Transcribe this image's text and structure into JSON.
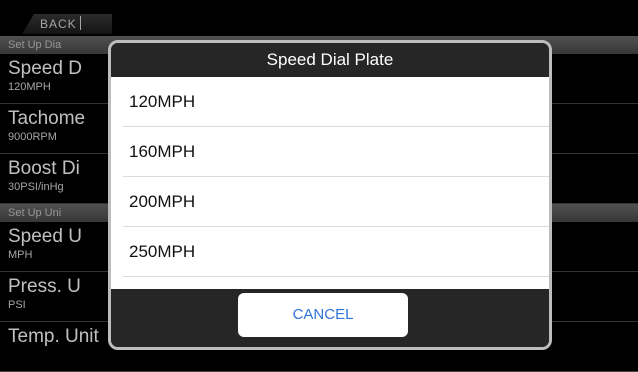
{
  "topbar": {
    "back_label": "BACK"
  },
  "list": {
    "section1": "Set Up Dia",
    "section2": "Set Up Uni",
    "rows": [
      {
        "title": "Speed D",
        "value": "120MPH"
      },
      {
        "title": "Tachome",
        "value": "9000RPM"
      },
      {
        "title": "Boost Di",
        "value": "30PSI/inHg"
      },
      {
        "title": "Speed U",
        "value": "MPH"
      },
      {
        "title": "Press. U",
        "value": "PSI"
      },
      {
        "title": "Temp. Unit",
        "value": ""
      }
    ]
  },
  "dialog": {
    "title": "Speed Dial Plate",
    "options": [
      "120MPH",
      "160MPH",
      "200MPH",
      "250MPH"
    ],
    "cancel_label": "CANCEL"
  }
}
